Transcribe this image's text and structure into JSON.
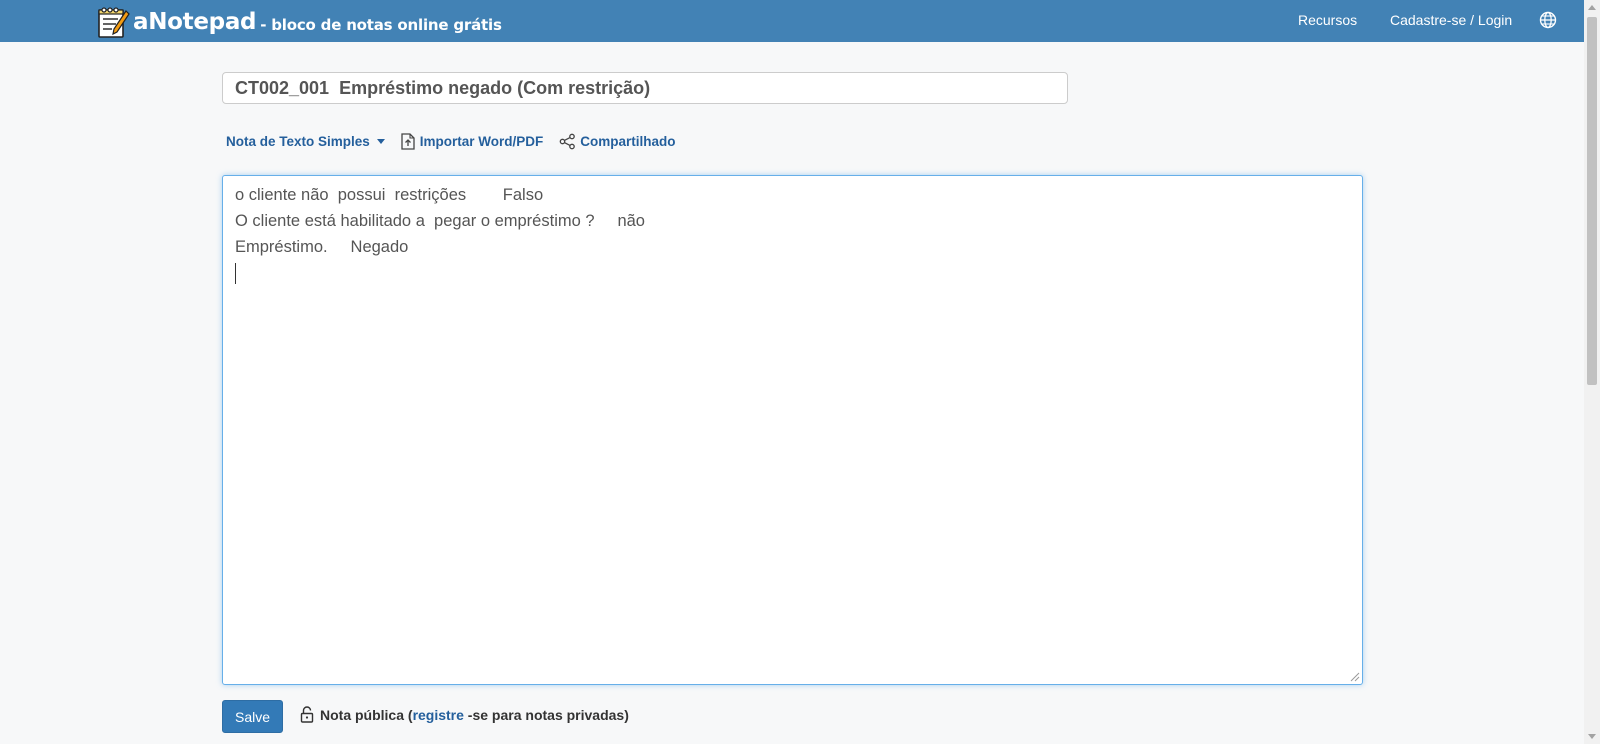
{
  "header": {
    "brand_name": "aNotepad",
    "tagline": "- bloco de notas online grátis",
    "nav": [
      "Recursos",
      "Cadastre-se / Login"
    ],
    "bg_color": "#4282b5"
  },
  "note": {
    "title": "CT002_001  Empréstimo negado (Com restrição)",
    "lines": [
      "o cliente não  possui  restrições        Falso",
      "O cliente está habilitado a  pegar o empréstimo ?     não",
      "Empréstimo.     Negado"
    ]
  },
  "toolbar": {
    "note_type": "Nota de Texto Simples",
    "import_label": "Importar Word/PDF",
    "share_label": "Compartilhado"
  },
  "footer": {
    "save_label": "Salve",
    "public_prefix": "Nota pública (",
    "register_link": "registre",
    "public_suffix": " -se para notas privadas)"
  },
  "icons": [
    "notepad-logo-icon",
    "globe-icon",
    "caret-down-icon",
    "file-upload-icon",
    "share-icon",
    "lock-icon"
  ],
  "colors": {
    "accent": "#337ab7",
    "link": "#245f9c",
    "focus": "#66afe9"
  }
}
